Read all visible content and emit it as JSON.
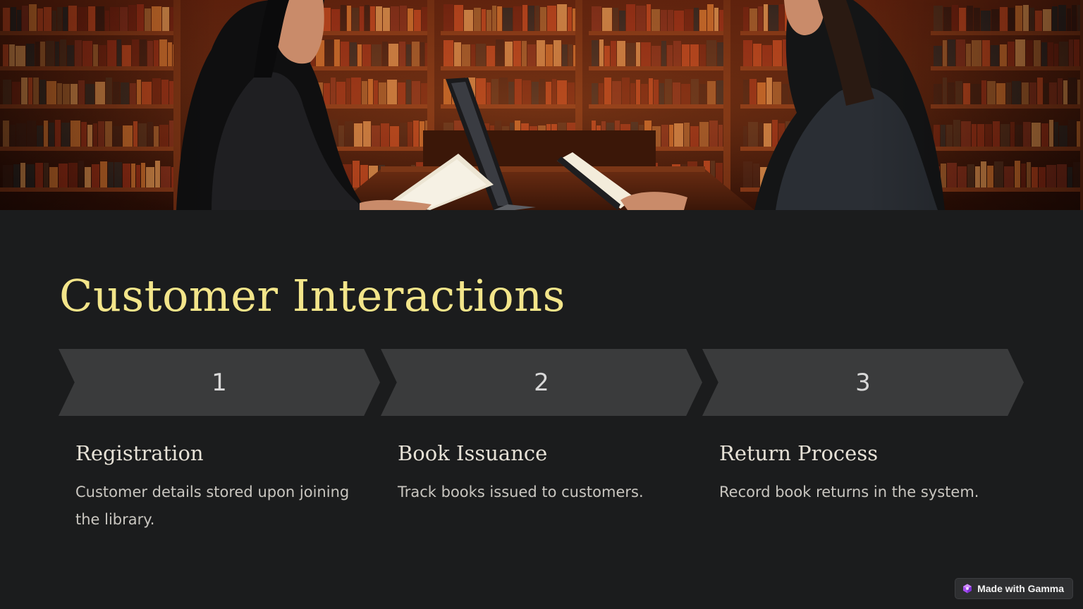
{
  "slide": {
    "title": "Customer Interactions",
    "steps": [
      {
        "number": "1",
        "title": "Registration",
        "description": "Customer details stored upon joining the library."
      },
      {
        "number": "2",
        "title": "Book Issuance",
        "description": "Track books issued to customers."
      },
      {
        "number": "3",
        "title": "Return Process",
        "description": "Record book returns in the system."
      }
    ]
  },
  "badge": {
    "label": "Made with Gamma",
    "icon": "gamma-logo-icon"
  },
  "colors": {
    "background": "#1b1c1d",
    "title": "#f3e58a",
    "chevron": "#3a3b3c",
    "step_title": "#e6e1d6",
    "step_text": "#c9c6c0"
  },
  "hero_image": {
    "icon": "library-scene-image"
  }
}
